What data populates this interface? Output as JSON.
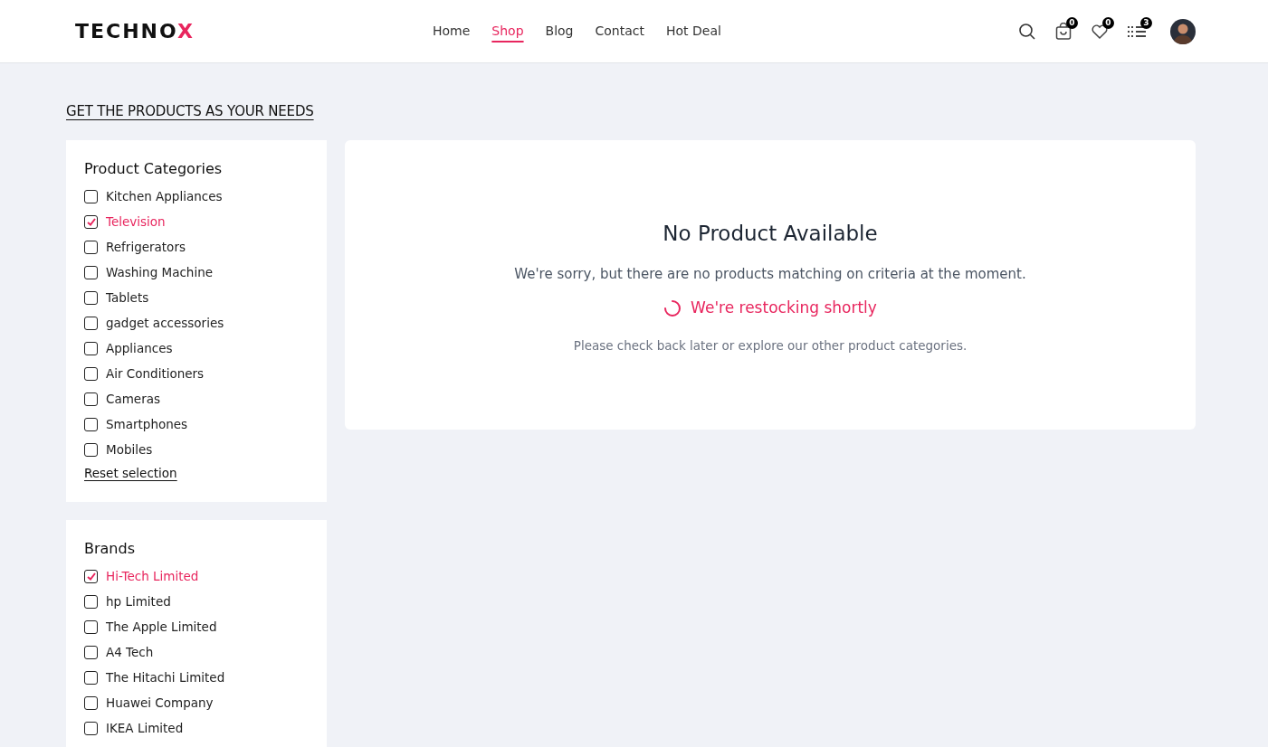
{
  "logo": {
    "text": "TECHNO",
    "accent": "X"
  },
  "nav": [
    {
      "label": "Home",
      "selected": false
    },
    {
      "label": "Shop",
      "selected": true
    },
    {
      "label": "Blog",
      "selected": false
    },
    {
      "label": "Contact",
      "selected": false
    },
    {
      "label": "Hot Deal",
      "selected": false
    }
  ],
  "header_icons": [
    {
      "kind": "search"
    },
    {
      "kind": "bag",
      "count": "0"
    },
    {
      "kind": "heart",
      "count": "0"
    },
    {
      "kind": "list",
      "count": "3"
    },
    {
      "kind": "avatar"
    }
  ],
  "page_heading": "GET THE PRODUCTS AS YOUR NEEDS",
  "filters": [
    {
      "title": "Product Categories",
      "reset": "Reset selection",
      "items": [
        {
          "label": "Kitchen Appliances",
          "checked": false
        },
        {
          "label": "Television",
          "checked": true
        },
        {
          "label": "Refrigerators",
          "checked": false
        },
        {
          "label": "Washing Machine",
          "checked": false
        },
        {
          "label": "Tablets",
          "checked": false
        },
        {
          "label": "gadget accessories",
          "checked": false
        },
        {
          "label": "Appliances",
          "checked": false
        },
        {
          "label": "Air Conditioners",
          "checked": false
        },
        {
          "label": "Cameras",
          "checked": false
        },
        {
          "label": "Smartphones",
          "checked": false
        },
        {
          "label": "Mobiles",
          "checked": false
        }
      ]
    },
    {
      "title": "Brands",
      "items": [
        {
          "label": "Hi-Tech Limited",
          "checked": true
        },
        {
          "label": "hp Limited",
          "checked": false
        },
        {
          "label": "The Apple Limited",
          "checked": false
        },
        {
          "label": "A4 Tech",
          "checked": false
        },
        {
          "label": "The Hitachi Limited",
          "checked": false
        },
        {
          "label": "Huawei Company",
          "checked": false
        },
        {
          "label": "IKEA Limited",
          "checked": false
        }
      ]
    }
  ],
  "empty_state": {
    "title": "No Product Available",
    "message": "We're sorry, but there are no products matching on criteria at the moment.",
    "status": "We're restocking shortly",
    "hint": "Please check back later or explore our other product categories."
  }
}
